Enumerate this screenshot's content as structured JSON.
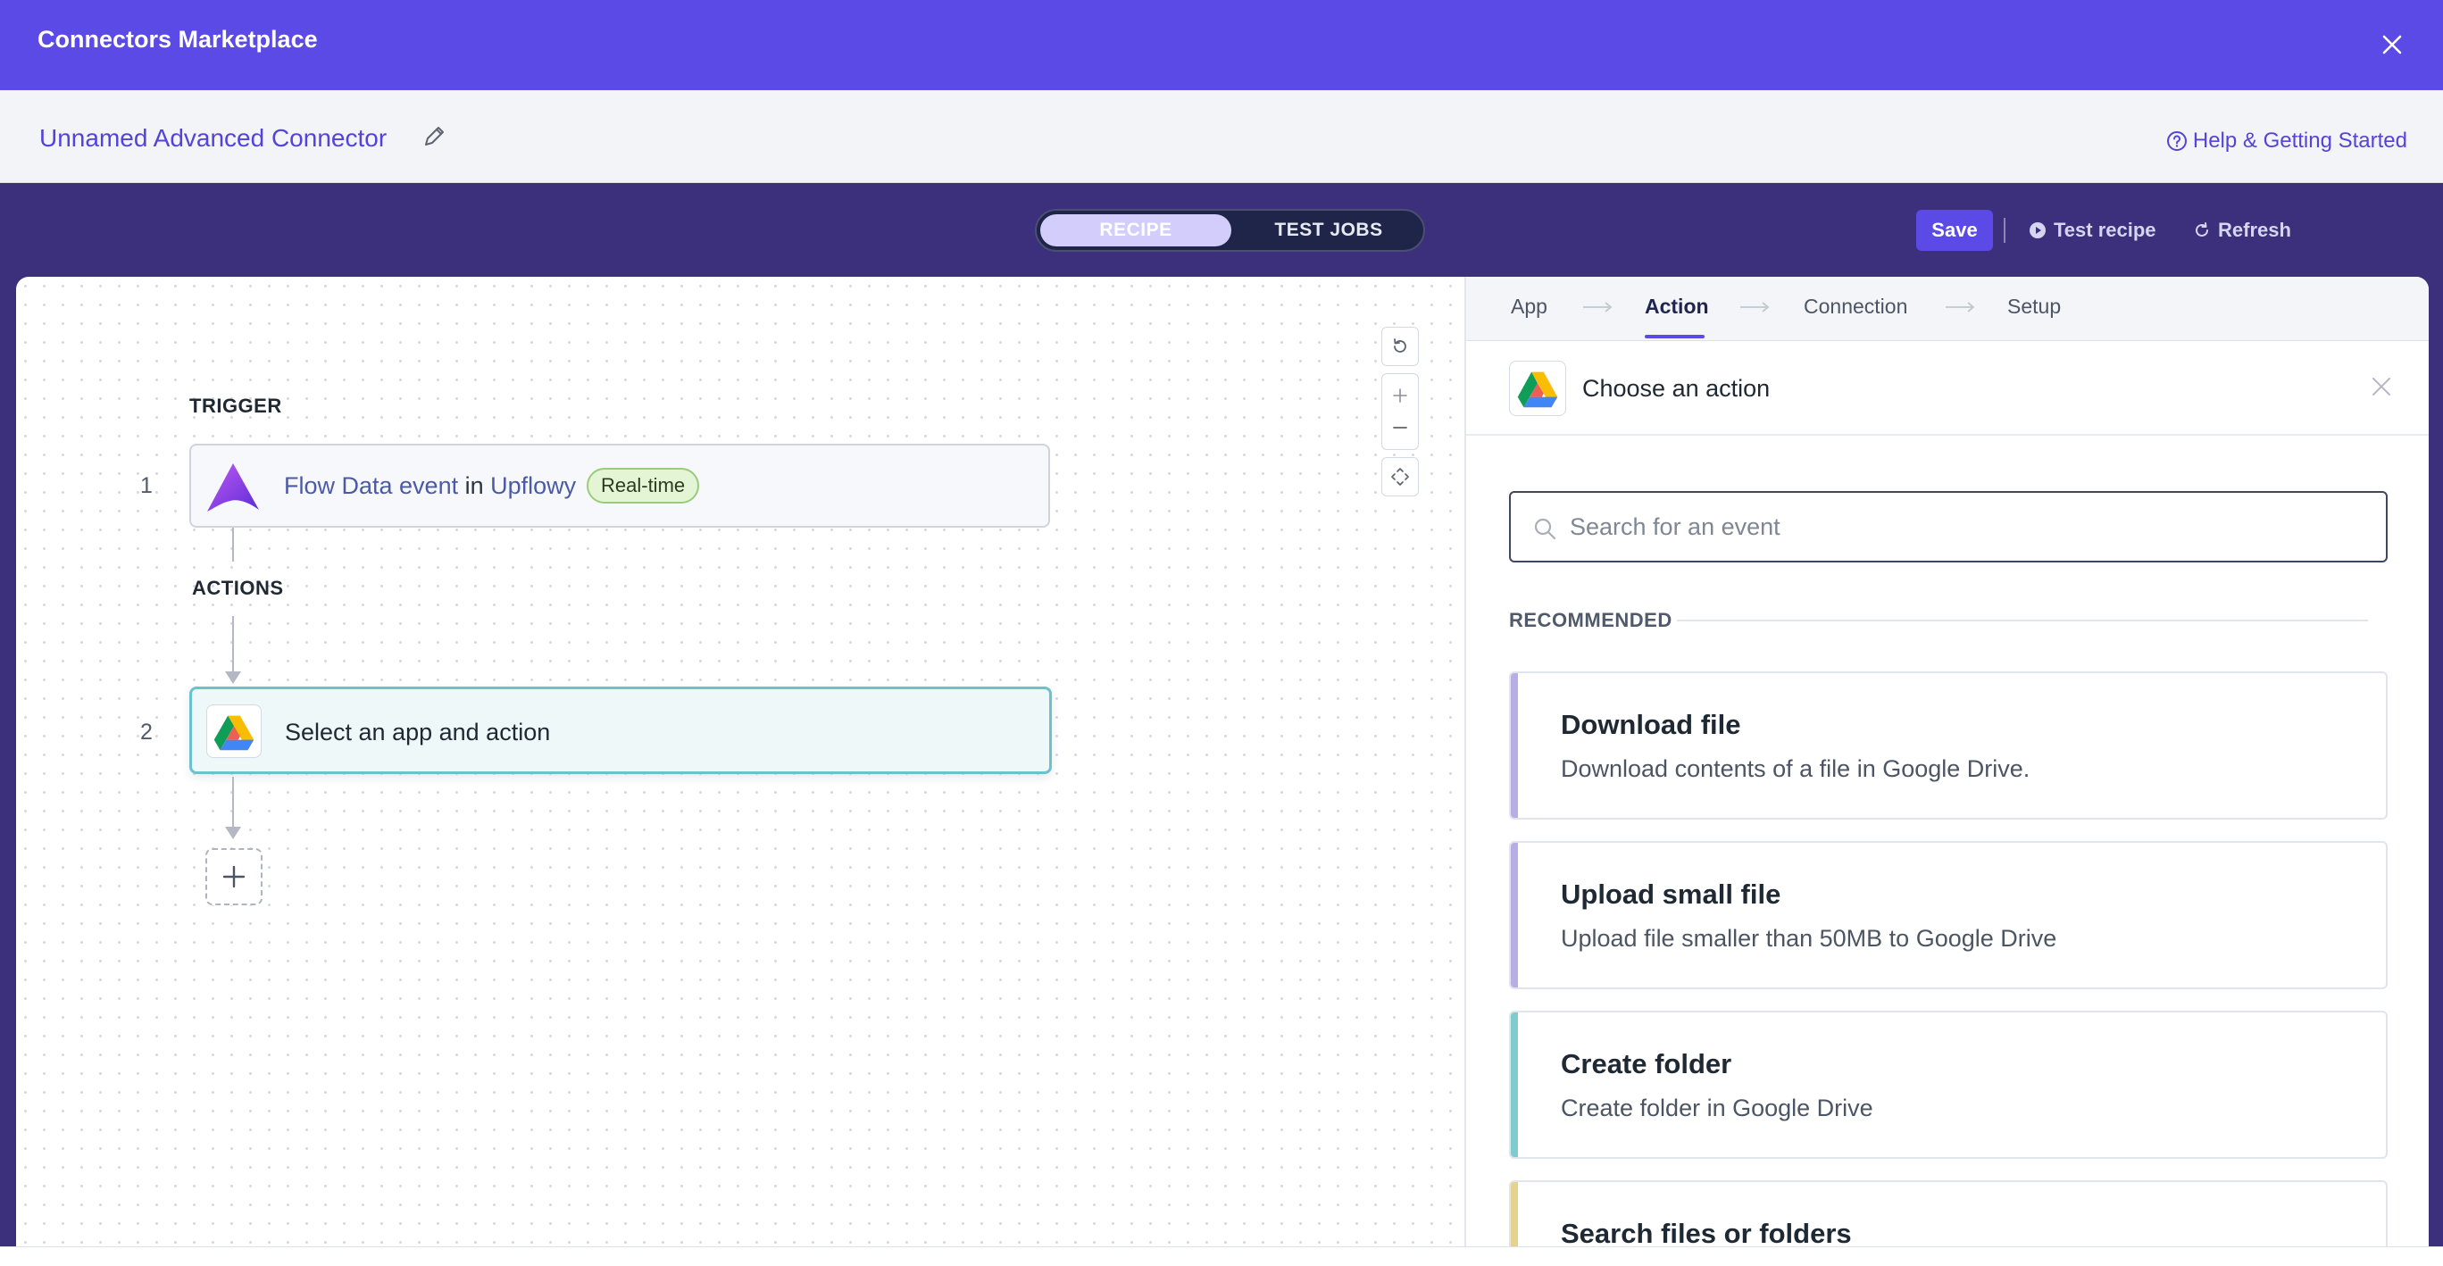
{
  "header": {
    "title": "Connectors Marketplace",
    "close_icon": "close-icon"
  },
  "subheader": {
    "connector_name": "Unnamed Advanced Connector",
    "edit_icon": "pencil-icon",
    "help_label": "Help & Getting Started",
    "help_icon": "question-circle-icon"
  },
  "toolbar": {
    "tabs": [
      {
        "label": "RECIPE",
        "active": true
      },
      {
        "label": "TEST JOBS",
        "active": false
      }
    ],
    "save_label": "Save",
    "test_recipe_label": "Test recipe",
    "refresh_label": "Refresh"
  },
  "canvas": {
    "trigger_label": "TRIGGER",
    "actions_label": "ACTIONS",
    "trigger_step": {
      "number": "1",
      "event": "Flow Data event",
      "connector_word": "in",
      "app": "Upflowy",
      "badge": "Real-time",
      "app_logo": "upflowy-logo"
    },
    "action_step": {
      "number": "2",
      "label": "Select an app and action",
      "app_logo": "google-drive-logo"
    },
    "add_step_icon": "plus-icon",
    "controls": [
      "reset-icon",
      "zoom-in-icon",
      "zoom-out-icon",
      "fit-view-icon"
    ]
  },
  "panel": {
    "steps": [
      "App",
      "Action",
      "Connection",
      "Setup"
    ],
    "active_step": "Action",
    "choose_label": "Choose an action",
    "search_placeholder": "Search for an event",
    "recommended_label": "RECOMMENDED",
    "events": [
      {
        "title": "Download file",
        "desc": "Download contents of a file in Google Drive.",
        "accent": "#b7aee6"
      },
      {
        "title": "Upload small file",
        "desc": "Upload file smaller than 50MB to Google Drive",
        "accent": "#b7aee6"
      },
      {
        "title": "Create folder",
        "desc": "Create folder in Google Drive",
        "accent": "#7fcccf"
      },
      {
        "title": "Search files or folders",
        "desc": "",
        "accent": "#e5d28c"
      }
    ]
  },
  "colors": {
    "brand": "#5b4ae6",
    "band": "#3c2f7c",
    "active_card_border": "#6cc2cb",
    "badge_bg": "#e3f5d5"
  }
}
